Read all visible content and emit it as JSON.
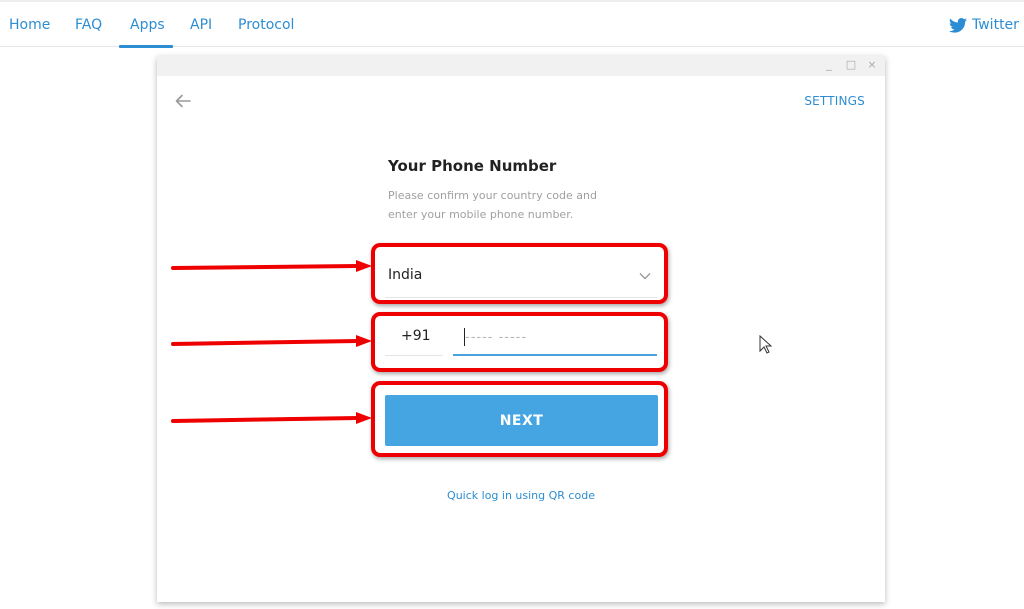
{
  "nav": {
    "items": [
      {
        "label": "Home"
      },
      {
        "label": "FAQ"
      },
      {
        "label": "Apps",
        "active": true
      },
      {
        "label": "API"
      },
      {
        "label": "Protocol"
      }
    ],
    "twitter": {
      "icon": "twitter-bird-icon",
      "label": "Twitter"
    }
  },
  "window": {
    "controls": {
      "minimize": "_",
      "maximize": "□",
      "close": "×"
    },
    "back_icon": "arrow-left-icon",
    "settings_label": "SETTINGS",
    "title": "Your Phone Number",
    "description": "Please confirm your country code and enter your mobile phone number.",
    "country": {
      "value": "India",
      "icon": "chevron-down-icon"
    },
    "country_code": "+91",
    "phone": {
      "value": "",
      "placeholder": "----- -----"
    },
    "next_label": "NEXT",
    "qr_link": "Quick log in using QR code"
  },
  "colors": {
    "accent": "#2d8dd2",
    "button": "#45a5e3",
    "annotation": "#ee0000"
  }
}
